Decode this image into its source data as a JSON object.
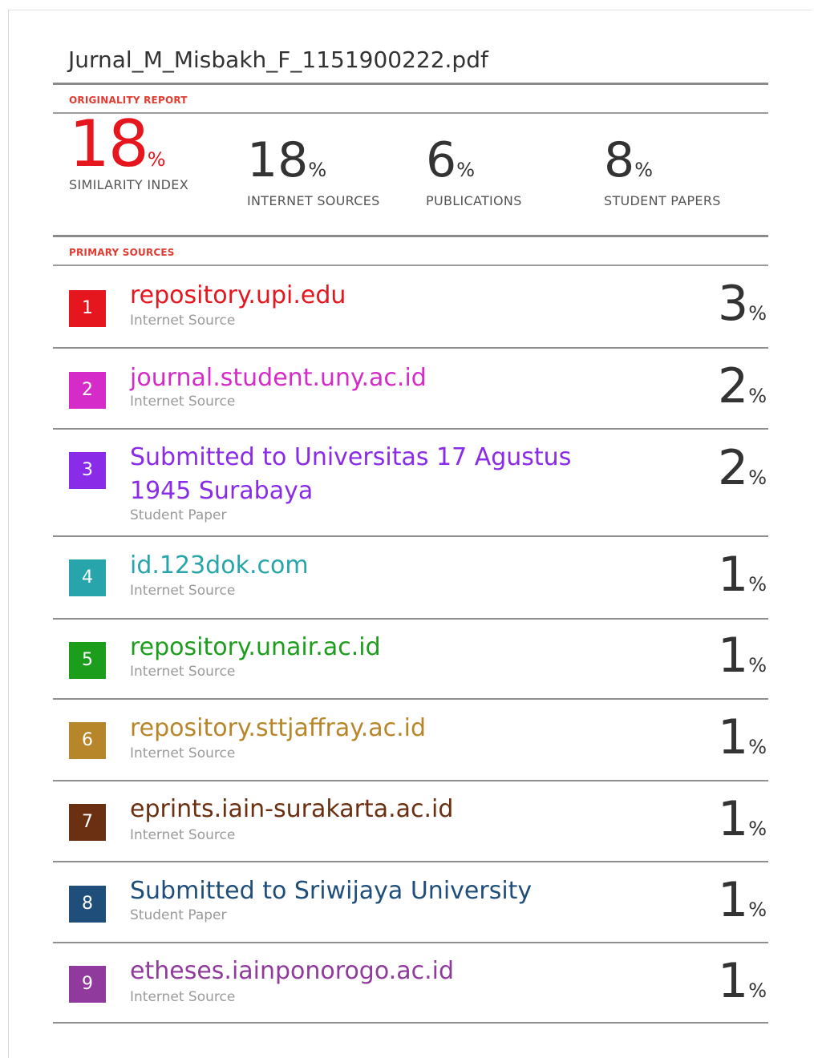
{
  "document": {
    "title": "Jurnal_M_Misbakh_F_1151900222.pdf"
  },
  "report": {
    "originality_label": "ORIGINALITY REPORT",
    "primary_sources_label": "PRIMARY SOURCES",
    "accent_color": "#e5161d"
  },
  "stats": {
    "similarity": {
      "value": "18",
      "unit": "%",
      "label": "SIMILARITY INDEX"
    },
    "internet": {
      "value": "18",
      "unit": "%",
      "label": "INTERNET SOURCES"
    },
    "publications": {
      "value": "6",
      "unit": "%",
      "label": "PUBLICATIONS"
    },
    "student": {
      "value": "8",
      "unit": "%",
      "label": "STUDENT PAPERS"
    }
  },
  "sources": [
    {
      "rank": "1",
      "name": "repository.upi.edu",
      "type": "Internet Source",
      "value": "3",
      "unit": "%",
      "color": "#e5161d"
    },
    {
      "rank": "2",
      "name": "journal.student.uny.ac.id",
      "type": "Internet Source",
      "value": "2",
      "unit": "%",
      "color": "#d52bc9"
    },
    {
      "rank": "3",
      "name": "Submitted to Universitas 17 Agustus 1945 Surabaya",
      "type": "Student Paper",
      "value": "2",
      "unit": "%",
      "color": "#8a2be8"
    },
    {
      "rank": "4",
      "name": "id.123dok.com",
      "type": "Internet Source",
      "value": "1",
      "unit": "%",
      "color": "#27a5ab"
    },
    {
      "rank": "5",
      "name": "repository.unair.ac.id",
      "type": "Internet Source",
      "value": "1",
      "unit": "%",
      "color": "#1c9e1c"
    },
    {
      "rank": "6",
      "name": "repository.sttjaffray.ac.id",
      "type": "Internet Source",
      "value": "1",
      "unit": "%",
      "color": "#b8862a"
    },
    {
      "rank": "7",
      "name": "eprints.iain-surakarta.ac.id",
      "type": "Internet Source",
      "value": "1",
      "unit": "%",
      "color": "#6b2f12"
    },
    {
      "rank": "8",
      "name": "Submitted to Sriwijaya University",
      "type": "Student Paper",
      "value": "1",
      "unit": "%",
      "color": "#1f4e7a"
    },
    {
      "rank": "9",
      "name": "etheses.iainponorogo.ac.id",
      "type": "Internet Source",
      "value": "1",
      "unit": "%",
      "color": "#8f3a9c"
    }
  ]
}
